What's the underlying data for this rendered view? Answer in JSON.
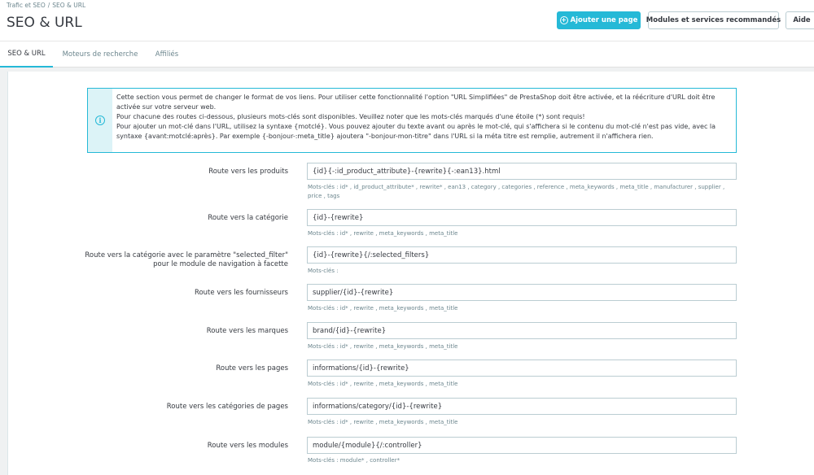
{
  "header": {
    "breadcrumb": [
      "Trafic et SEO",
      "SEO & URL"
    ],
    "title": "SEO & URL",
    "add_page_label": "Ajouter une page",
    "modules_label": "Modules et services recommandés",
    "help_label": "Aide"
  },
  "tabs": [
    {
      "label": "SEO & URL",
      "active": true
    },
    {
      "label": "Moteurs de recherche",
      "active": false
    },
    {
      "label": "Affiliés",
      "active": false
    }
  ],
  "info": {
    "lines": [
      "Cette section vous permet de changer le format de vos liens. Pour utiliser cette fonctionnalité l'option \"URL Simplifiées\" de PrestaShop doit être activée, et la réécriture d'URL doit être activée sur votre serveur web.",
      "Pour chacune des routes ci-dessous, plusieurs mots-clés sont disponibles. Veuillez noter que les mots-clés marqués d'une étoile (*) sont requis!",
      "Pour ajouter un mot-clé dans l'URL, utilisez la syntaxe {motclé}. Vous pouvez ajouter du texte avant ou après le mot-clé, qui s'affichera si le contenu du mot-clé n'est pas vide, avec la syntaxe {avant:motclé:après}. Par exemple {-bonjour-:meta_title} ajoutera \"-bonjour-mon-titre\" dans l'URL si la méta titre est remplie, autrement il n'affichera rien."
    ]
  },
  "routes": [
    {
      "label": "Route vers les produits",
      "value": "{id}{-:id_product_attribute}-{rewrite}{-:ean13}.html",
      "help": "Mots-clés : id* , id_product_attribute* , rewrite* , ean13 , category , categories , reference , meta_keywords , meta_title , manufacturer , supplier , price , tags"
    },
    {
      "label": "Route vers la catégorie",
      "value": "{id}-{rewrite}",
      "help": "Mots-clés : id* , rewrite , meta_keywords , meta_title"
    },
    {
      "label": "Route vers la catégorie avec le paramètre \"selected_filter\"",
      "label2": "pour le module de navigation à facette",
      "value": "{id}-{rewrite}{/:selected_filters}",
      "help": "Mots-clés :"
    },
    {
      "label": "Route vers les fournisseurs",
      "value": "supplier/{id}-{rewrite}",
      "help": "Mots-clés : id* , rewrite , meta_keywords , meta_title"
    },
    {
      "label": "Route vers les marques",
      "value": "brand/{id}-{rewrite}",
      "help": "Mots-clés : id* , rewrite , meta_keywords , meta_title"
    },
    {
      "label": "Route vers les pages",
      "value": "informations/{id}-{rewrite}",
      "help": "Mots-clés : id* , rewrite , meta_keywords , meta_title"
    },
    {
      "label": "Route vers les catégories de pages",
      "value": "informations/category/{id}-{rewrite}",
      "help": "Mots-clés : id* , rewrite , meta_keywords , meta_title"
    },
    {
      "label": "Route vers les modules",
      "value": "module/{module}{/:controller}",
      "help": "Mots-clés : module* , controller*"
    }
  ],
  "colors": {
    "accent": "#25b9d7",
    "info_bg": "#dcf3f7"
  },
  "icons": {
    "add_page": "plus-circle-icon",
    "info": "info-icon"
  }
}
